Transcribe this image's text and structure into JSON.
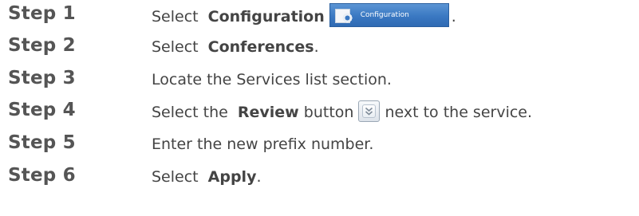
{
  "steps": [
    {
      "label": "Step 1",
      "parts": {
        "pre": "Select ",
        "bold": "Configuration",
        "post": "."
      },
      "button": {
        "label": "Configuration",
        "icon": "configuration-icon",
        "color": "#3a78c2"
      }
    },
    {
      "label": "Step 2",
      "parts": {
        "pre": "Select ",
        "bold": "Conferences",
        "post": "."
      }
    },
    {
      "label": "Step 3",
      "parts": {
        "pre": "Locate the Services list section.",
        "bold": "",
        "post": ""
      }
    },
    {
      "label": "Step 4",
      "parts": {
        "pre": "Select the ",
        "bold": "Review",
        "post": " button",
        "after": "next to the service."
      },
      "button": {
        "icon": "double-chevron-down-icon"
      }
    },
    {
      "label": "Step 5",
      "parts": {
        "pre": "Enter the new prefix number.",
        "bold": "",
        "post": ""
      }
    },
    {
      "label": "Step 6",
      "parts": {
        "pre": "Select ",
        "bold": "Apply",
        "post": "."
      }
    }
  ]
}
